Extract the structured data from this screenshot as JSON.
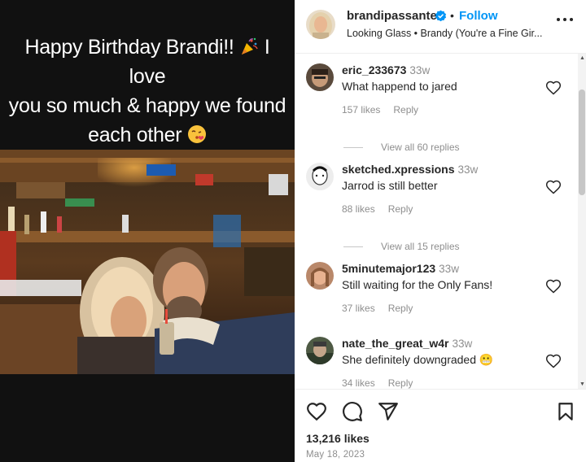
{
  "story": {
    "caption": "Happy Birthday Brandi!! 🎉 I love you so much & happy we found each other 😘",
    "caption_line1": "Happy Birthday Brandi!!",
    "caption_line1b": "I love",
    "caption_line2": "you so much & happy we found",
    "caption_line3": "each other"
  },
  "header": {
    "username": "brandipassante",
    "separator": "•",
    "follow_label": "Follow",
    "music": "Looking Glass • Brandy (You're a Fine Gir..."
  },
  "comments": [
    {
      "username": "eric_233673",
      "time": "33w",
      "text": "What happend to jared",
      "likes": "157 likes",
      "reply": "Reply",
      "view_replies": "View all 60 replies"
    },
    {
      "username": "sketched.xpressions",
      "time": "33w",
      "text": "Jarrod is still better",
      "likes": "88 likes",
      "reply": "Reply",
      "view_replies": "View all 15 replies"
    },
    {
      "username": "5minutemajor123",
      "time": "33w",
      "text": "Still waiting for the Only Fans!",
      "likes": "37 likes",
      "reply": "Reply"
    },
    {
      "username": "nate_the_great_w4r",
      "time": "33w",
      "text": "She definitely downgraded 😬",
      "likes": "34 likes",
      "reply": "Reply"
    }
  ],
  "footer": {
    "likes_count": "13,216 likes",
    "date": "May 18, 2023"
  },
  "icons": {
    "like": "heart-icon",
    "comment": "comment-icon",
    "share": "share-icon",
    "save": "bookmark-icon",
    "more": "more-options-icon",
    "verified": "verified-badge-icon"
  },
  "colors": {
    "follow": "#0095f6",
    "verified": "#0095f6",
    "muted": "#8e8e8e"
  }
}
